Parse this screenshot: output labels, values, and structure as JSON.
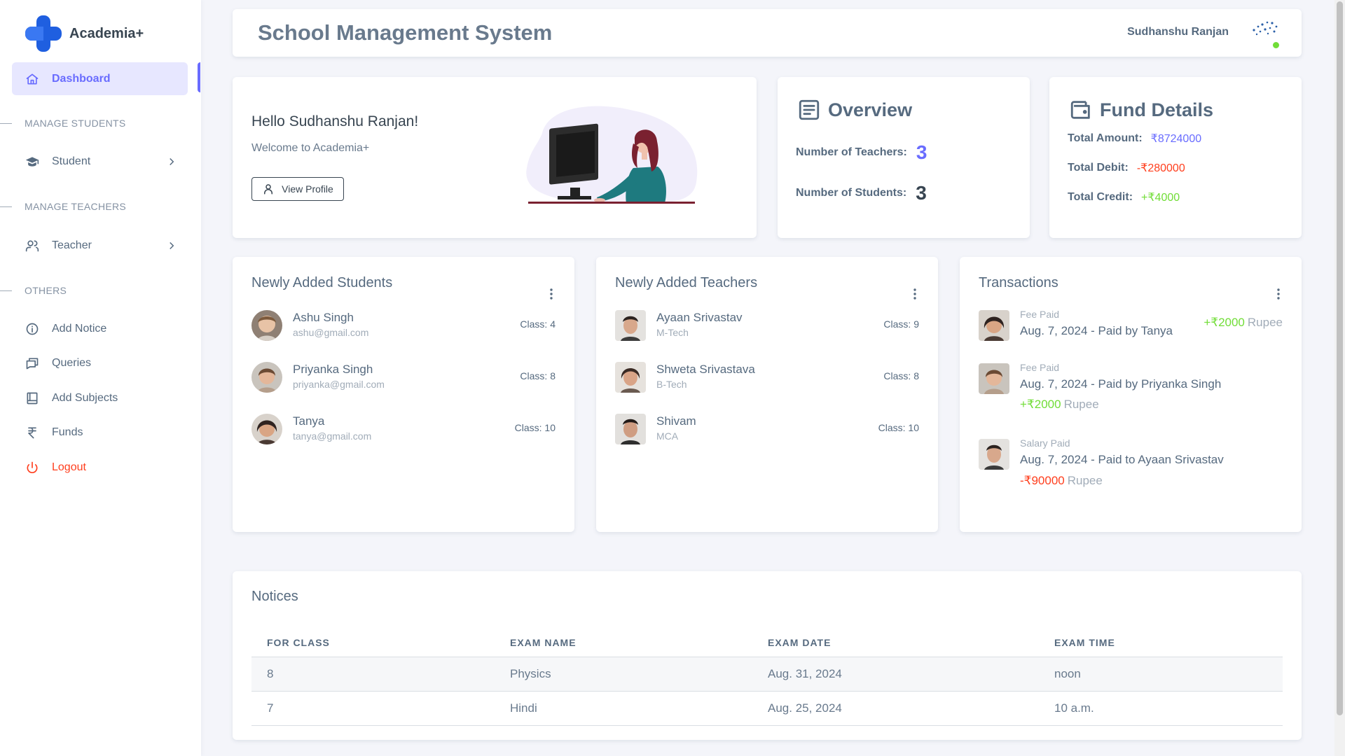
{
  "brand": {
    "name": "Academia+"
  },
  "sidebar": {
    "active": {
      "label": "Dashboard",
      "icon": "home-icon"
    },
    "sections": [
      {
        "heading": "MANAGE STUDENTS"
      },
      {
        "heading": "MANAGE TEACHERS"
      },
      {
        "heading": "OTHERS"
      }
    ],
    "items": {
      "student": {
        "label": "Student",
        "icon": "graduation-cap-icon"
      },
      "teacher": {
        "label": "Teacher",
        "icon": "users-icon"
      },
      "add_notice": {
        "label": "Add Notice",
        "icon": "info-icon"
      },
      "queries": {
        "label": "Queries",
        "icon": "messages-icon"
      },
      "add_subjects": {
        "label": "Add Subjects",
        "icon": "book-icon"
      },
      "funds": {
        "label": "Funds",
        "icon": "rupee-icon"
      },
      "logout": {
        "label": "Logout",
        "icon": "power-icon"
      }
    }
  },
  "header": {
    "title": "School Management System",
    "user": "Sudhanshu Ranjan"
  },
  "welcome": {
    "greeting": "Hello Sudhanshu Ranjan!",
    "subtitle": "Welcome to Academia+",
    "button": "View Profile"
  },
  "overview": {
    "title": "Overview",
    "teachers_label": "Number of Teachers:",
    "teachers_value": "3",
    "students_label": "Number of Students:",
    "students_value": "3"
  },
  "fund_details": {
    "title": "Fund Details",
    "total_amount_label": "Total Amount:",
    "total_amount": "₹8724000",
    "total_debit_label": "Total Debit:",
    "total_debit": "-₹280000",
    "total_credit_label": "Total Credit:",
    "total_credit": "+₹4000"
  },
  "students": {
    "title": "Newly Added Students",
    "items": [
      {
        "name": "Ashu Singh",
        "sub": "ashu@gmail.com",
        "class": "Class: 4"
      },
      {
        "name": "Priyanka Singh",
        "sub": "priyanka@gmail.com",
        "class": "Class: 8"
      },
      {
        "name": "Tanya",
        "sub": "tanya@gmail.com",
        "class": "Class: 10"
      }
    ]
  },
  "teachers": {
    "title": "Newly Added Teachers",
    "items": [
      {
        "name": "Ayaan Srivastav",
        "sub": "M-Tech",
        "class": "Class: 9"
      },
      {
        "name": "Shweta Srivastava",
        "sub": "B-Tech",
        "class": "Class: 8"
      },
      {
        "name": "Shivam",
        "sub": "MCA",
        "class": "Class: 10"
      }
    ]
  },
  "transactions": {
    "title": "Transactions",
    "items": [
      {
        "label": "Fee Paid",
        "desc": "Aug. 7, 2024 - Paid by Tanya",
        "amount": "+₹2000",
        "unit": "Rupee"
      },
      {
        "label": "Fee Paid",
        "desc": "Aug. 7, 2024 - Paid by Priyanka Singh",
        "amount": "+₹2000",
        "unit": "Rupee"
      },
      {
        "label": "Salary Paid",
        "desc": "Aug. 7, 2024 - Paid to Ayaan Srivastav",
        "amount": "-₹90000",
        "unit": "Rupee"
      }
    ]
  },
  "notices": {
    "title": "Notices",
    "columns": [
      "FOR CLASS",
      "EXAM NAME",
      "EXAM DATE",
      "EXAM TIME"
    ],
    "rows": [
      [
        "8",
        "Physics",
        "Aug. 31, 2024",
        "noon"
      ],
      [
        "7",
        "Hindi",
        "Aug. 25, 2024",
        "10 a.m."
      ]
    ]
  },
  "colors": {
    "primary": "#696cff",
    "success": "#71dd37",
    "danger": "#ff3e1d",
    "text": "#566a7f",
    "muted": "#a1acb8",
    "background": "#f4f5fa"
  }
}
